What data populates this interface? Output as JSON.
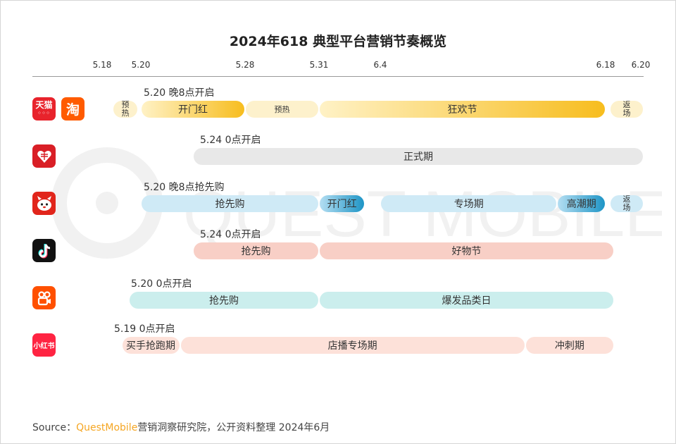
{
  "title": "2024年618 典型平台营销节奏概览",
  "chart_data": {
    "type": "gantt",
    "axis_ticks": [
      "5.18",
      "5.20",
      "5.28",
      "5.31",
      "6.4",
      "6.18",
      "6.20"
    ],
    "platforms": [
      {
        "logo_icons": [
          "tmall-icon",
          "taobao-icon"
        ],
        "note": "5.20 晚8点开启",
        "segments": [
          {
            "label": "预热",
            "start": "5.16",
            "end": "5.19",
            "style": "yellow-light"
          },
          {
            "label": "开门红",
            "start": "5.20",
            "end": "5.28",
            "style": "yellow-strong"
          },
          {
            "label": "预热",
            "start": "5.28",
            "end": "5.31",
            "style": "yellow-light"
          },
          {
            "label": "狂欢节",
            "start": "5.31",
            "end": "6.18",
            "style": "yellow-strong"
          },
          {
            "label": "返场",
            "start": "6.19",
            "end": "6.20",
            "style": "yellow-light"
          }
        ]
      },
      {
        "logo_icons": [
          "pinduoduo-icon"
        ],
        "note": "5.24 0点开启",
        "segments": [
          {
            "label": "正式期",
            "start": "5.24",
            "end": "6.20",
            "style": "gray"
          }
        ]
      },
      {
        "logo_icons": [
          "jd-icon"
        ],
        "note": "5.20 晚8点抢先购",
        "segments": [
          {
            "label": "抢先购",
            "start": "5.20",
            "end": "5.31",
            "style": "blue-light"
          },
          {
            "label": "开门红",
            "start": "5.31",
            "end": "6.3",
            "style": "blue-strong"
          },
          {
            "label": "专场期",
            "start": "6.4",
            "end": "6.15",
            "style": "blue-light"
          },
          {
            "label": "高潮期",
            "start": "6.15",
            "end": "6.18",
            "style": "blue-strong"
          },
          {
            "label": "返场",
            "start": "6.19",
            "end": "6.20",
            "style": "blue-light"
          }
        ]
      },
      {
        "logo_icons": [
          "douyin-icon"
        ],
        "note": "5.24 0点开启",
        "segments": [
          {
            "label": "抢先购",
            "start": "5.24",
            "end": "5.31",
            "style": "salmon"
          },
          {
            "label": "好物节",
            "start": "5.31",
            "end": "6.18",
            "style": "salmon"
          }
        ]
      },
      {
        "logo_icons": [
          "kuaishou-icon"
        ],
        "note": "5.20 0点开启",
        "segments": [
          {
            "label": "抢先购",
            "start": "5.20",
            "end": "5.31",
            "style": "teal"
          },
          {
            "label": "爆发品类日",
            "start": "5.31",
            "end": "6.18",
            "style": "teal"
          }
        ]
      },
      {
        "logo_icons": [
          "xiaohongshu-icon"
        ],
        "note": "5.19 0点开启",
        "segments": [
          {
            "label": "买手抢跑期",
            "start": "5.19",
            "end": "5.23",
            "style": "peach"
          },
          {
            "label": "店播专场期",
            "start": "5.23",
            "end": "6.13",
            "style": "peach"
          },
          {
            "label": "冲刺期",
            "start": "6.13",
            "end": "6.18",
            "style": "peach"
          }
        ]
      }
    ]
  },
  "logos": {
    "tmall": "天猫",
    "taobao": "淘",
    "xiaohongshu": "小红书"
  },
  "watermark": "QUEST MOBILE",
  "colors": {
    "yellow-light": "#fdf1cc",
    "yellow-strong-from": "#fff2c6",
    "yellow-strong-to": "#f7bd1e",
    "gray": "#e8e8e8",
    "blue-light": "#cfeaf6",
    "blue-strong-from": "#b4def2",
    "blue-strong-to": "#1e95c6",
    "salmon": "#f8cfc6",
    "teal": "#cbeeed",
    "peach": "#fde1d9"
  },
  "source": {
    "prefix": "Source：",
    "brand": "QuestMobile",
    "rest": "营销洞察研究院，公开资料整理 2024年6月"
  }
}
